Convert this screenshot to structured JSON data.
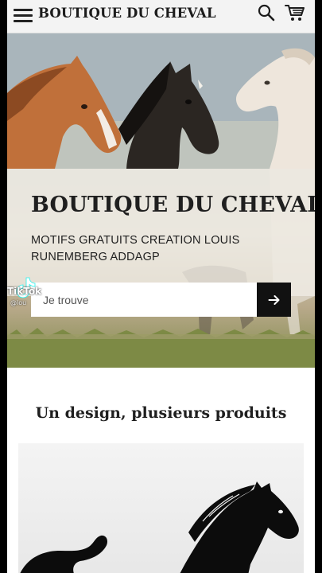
{
  "header": {
    "brand": "BOUTIQUE DU CHEVAL",
    "menu_icon": "hamburger-menu-icon",
    "search_icon": "search-icon",
    "cart_icon": "cart-icon"
  },
  "hero": {
    "title": "BOUTIQUE DU CHEVAL",
    "subtitle": "MOTIFS GRATUITS CREATION LOUIS RUNEMBERG ADDAGP",
    "search": {
      "placeholder": "Je trouve",
      "submit_icon": "arrow-right-icon"
    }
  },
  "overlay": {
    "app_name": "TikTok",
    "handle": "@lou"
  },
  "section": {
    "title": "Un design, plusieurs produits"
  },
  "colors": {
    "header_bg": "#f3f3f3",
    "button_bg": "#111111",
    "text": "#1f1f1f"
  }
}
